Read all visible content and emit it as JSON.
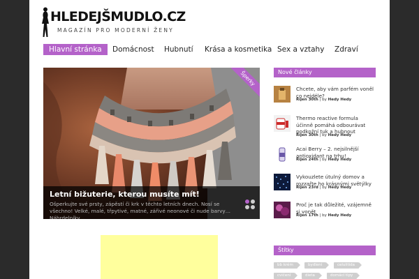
{
  "logo": {
    "brand": "HLEDEJŠMUDLO.CZ",
    "tagline": "MAGAZÍN PRO MODERNÍ ŽENY"
  },
  "nav": {
    "items": [
      {
        "label": "Hlavní stránka",
        "active": true
      },
      {
        "label": "Domácnost",
        "active": false
      },
      {
        "label": "Hubnutí",
        "active": false
      },
      {
        "label": "Krása a kosmetika",
        "active": false
      },
      {
        "label": "Sex a vztahy",
        "active": false
      },
      {
        "label": "Zdraví",
        "active": false
      }
    ]
  },
  "featured": {
    "ribbon": "Šperky",
    "title": "Letní bižuterie, kterou musíte mít!",
    "excerpt": "Ošperkujte své prsty, zápěstí či krk v těchto letních dnech. Nosí se všechno! Velké, malé, třpytivé, matné, zářivé neonové či nude barvy… Náhrdelníky"
  },
  "sidebar": {
    "new_articles_title": "Nové články",
    "posts": [
      {
        "title": "Chcete, aby vám parfém voněl co nejdéle?",
        "date": "Říjen 30th",
        "sep": " | by ",
        "author": "Hedy Hedy"
      },
      {
        "title": "Thermo reactive formula účinně pomáhá odbourávat podkožní tuk a hubnout",
        "date": "Říjen 30th",
        "sep": " | by ",
        "author": "Hedy Hedy"
      },
      {
        "title": "Acai Berry – 2. nejsilnější antioxidant na trhu!",
        "date": "Říjen 24th",
        "sep": " | by ",
        "author": "Hedy Hedy"
      },
      {
        "title": "Vykouzlete útulný domov a rozzařte ho krásnými světýlky",
        "date": "Říjen 23rd",
        "sep": " | by ",
        "author": "Hedy Hedy"
      },
      {
        "title": "Proč je tak důležité, vzájemně si vonět",
        "date": "Říjen 17th",
        "sep": " | by ",
        "author": "Hedy Hedy"
      }
    ],
    "tags_title": "Štítky",
    "tags": [
      "bb krém",
      "bydlení",
      "celulitida",
      "cvičení",
      "dieta",
      "domácí tipy"
    ]
  }
}
